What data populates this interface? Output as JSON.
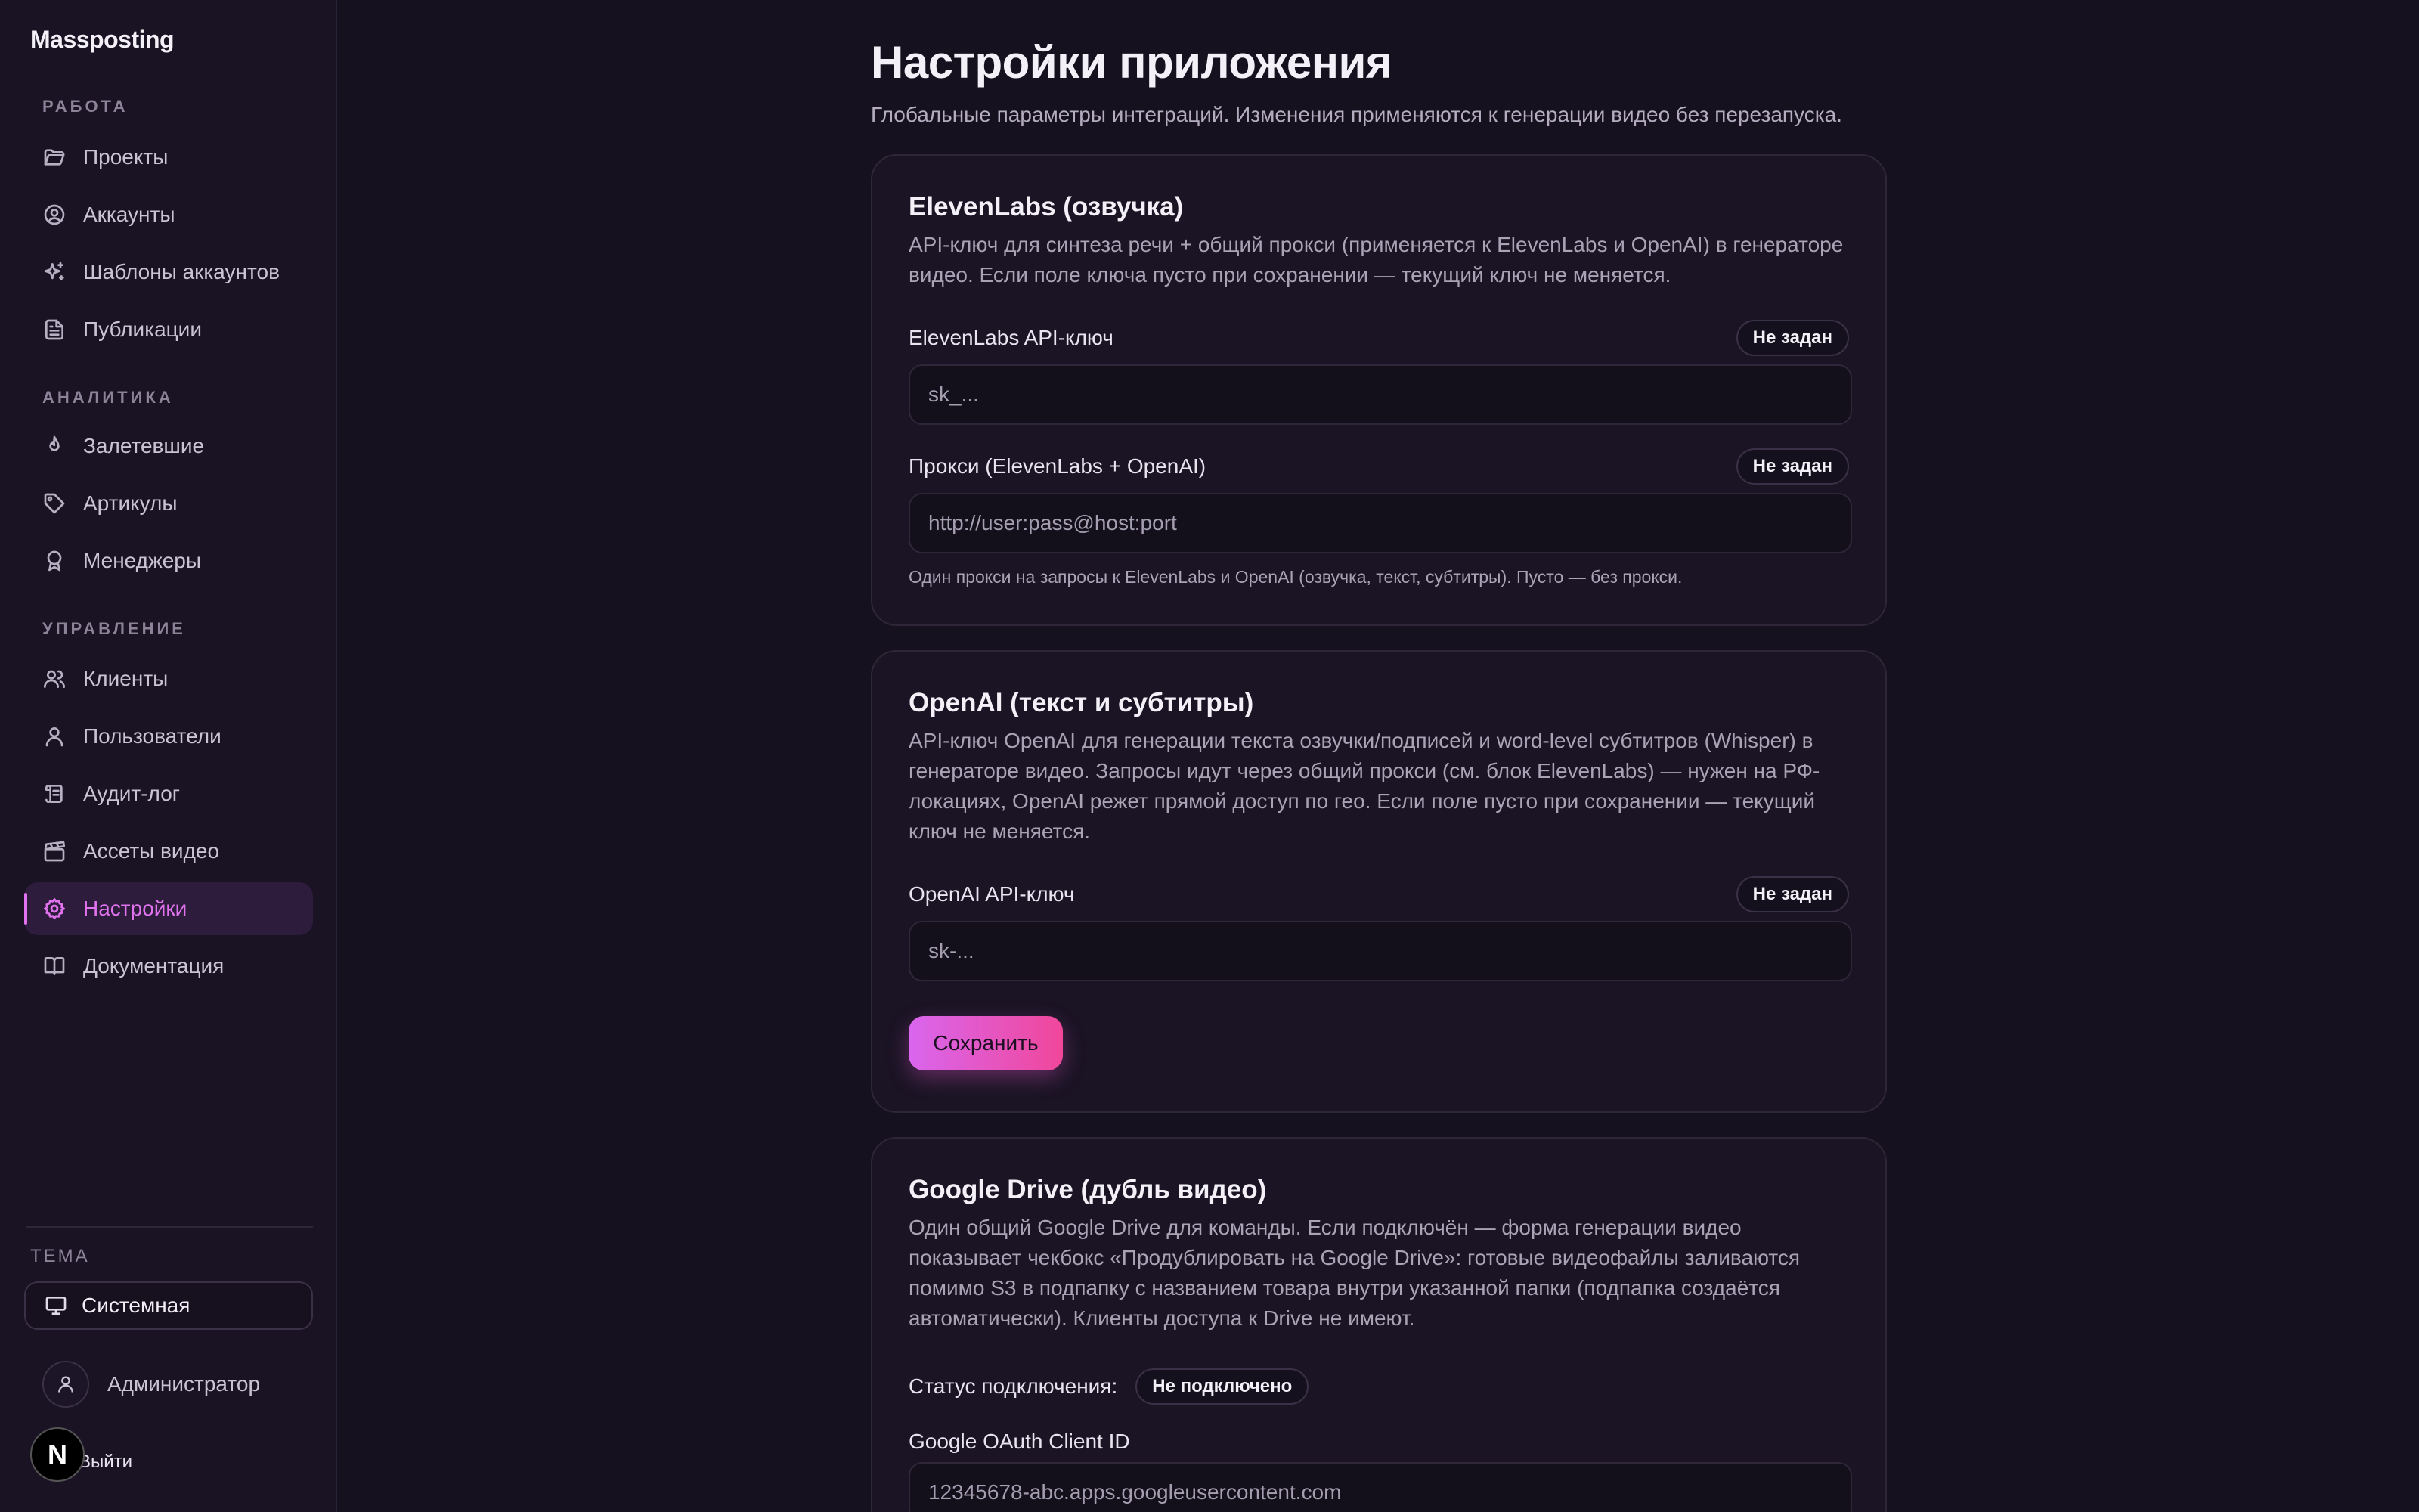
{
  "sidebar": {
    "brand": "Massposting",
    "sections": [
      {
        "label": "РАБОТА",
        "items": [
          {
            "label": "Проекты",
            "icon": "folder-icon"
          },
          {
            "label": "Аккаунты",
            "icon": "user-circle-icon"
          },
          {
            "label": "Шаблоны аккаунтов",
            "icon": "sparkles-icon"
          },
          {
            "label": "Публикации",
            "icon": "document-icon"
          }
        ]
      },
      {
        "label": "АНАЛИТИКА",
        "items": [
          {
            "label": "Залетевшие",
            "icon": "flame-icon"
          },
          {
            "label": "Артикулы",
            "icon": "tag-icon"
          },
          {
            "label": "Менеджеры",
            "icon": "award-icon"
          }
        ]
      },
      {
        "label": "УПРАВЛЕНИЕ",
        "items": [
          {
            "label": "Клиенты",
            "icon": "users-icon"
          },
          {
            "label": "Пользователи",
            "icon": "user-icon"
          },
          {
            "label": "Аудит-лог",
            "icon": "scroll-icon"
          },
          {
            "label": "Ассеты видео",
            "icon": "clapperboard-icon"
          },
          {
            "label": "Настройки",
            "icon": "gear-icon",
            "active": true
          },
          {
            "label": "Документация",
            "icon": "book-icon"
          }
        ]
      }
    ],
    "theme_label": "ТЕМА",
    "theme_value": "Системная",
    "user_name": "Администратор",
    "logout": "Выйти",
    "n_badge": "N"
  },
  "page": {
    "title": "Настройки приложения",
    "subtitle": "Глобальные параметры интеграций. Изменения применяются к генерации видео без перезапуска."
  },
  "elevenlabs": {
    "title": "ElevenLabs (озвучка)",
    "desc": "API-ключ для синтеза речи + общий прокси (применяется к ElevenLabs и OpenAI) в генераторе видео. Если поле ключа пусто при сохранении — текущий ключ не меняется.",
    "key_label": "ElevenLabs API-ключ",
    "key_badge": "Не задан",
    "key_placeholder": "sk_...",
    "proxy_label": "Прокси (ElevenLabs + OpenAI)",
    "proxy_badge": "Не задан",
    "proxy_placeholder": "http://user:pass@host:port",
    "proxy_hint": "Один прокси на запросы к ElevenLabs и OpenAI (озвучка, текст, субтитры). Пусто — без прокси."
  },
  "openai": {
    "title": "OpenAI (текст и субтитры)",
    "desc": "API-ключ OpenAI для генерации текста озвучки/подписей и word-level субтитров (Whisper) в генераторе видео. Запросы идут через общий прокси (см. блок ElevenLabs) — нужен на РФ-локациях, OpenAI режет прямой доступ по гео. Если поле пусто при сохранении — текущий ключ не меняется.",
    "key_label": "OpenAI API-ключ",
    "key_badge": "Не задан",
    "key_placeholder": "sk-...",
    "save_label": "Сохранить"
  },
  "gdrive": {
    "title": "Google Drive (дубль видео)",
    "desc": "Один общий Google Drive для команды. Если подключён — форма генерации видео показывает чекбокс «Продублировать на Google Drive»: готовые видеофайлы заливаются помимо S3 в подпапку с названием товара внутри указанной папки (подпапка создаётся автоматически). Клиенты доступа к Drive не имеют.",
    "status_label": "Статус подключения:",
    "status_badge": "Не подключено",
    "client_id_label": "Google OAuth Client ID",
    "client_id_placeholder": "12345678-abc.apps.googleusercontent.com"
  },
  "colors": {
    "accent": "#e173ee",
    "button_gradient_start": "#d966ee",
    "button_gradient_end": "#f0479a",
    "background": "#16111f"
  }
}
